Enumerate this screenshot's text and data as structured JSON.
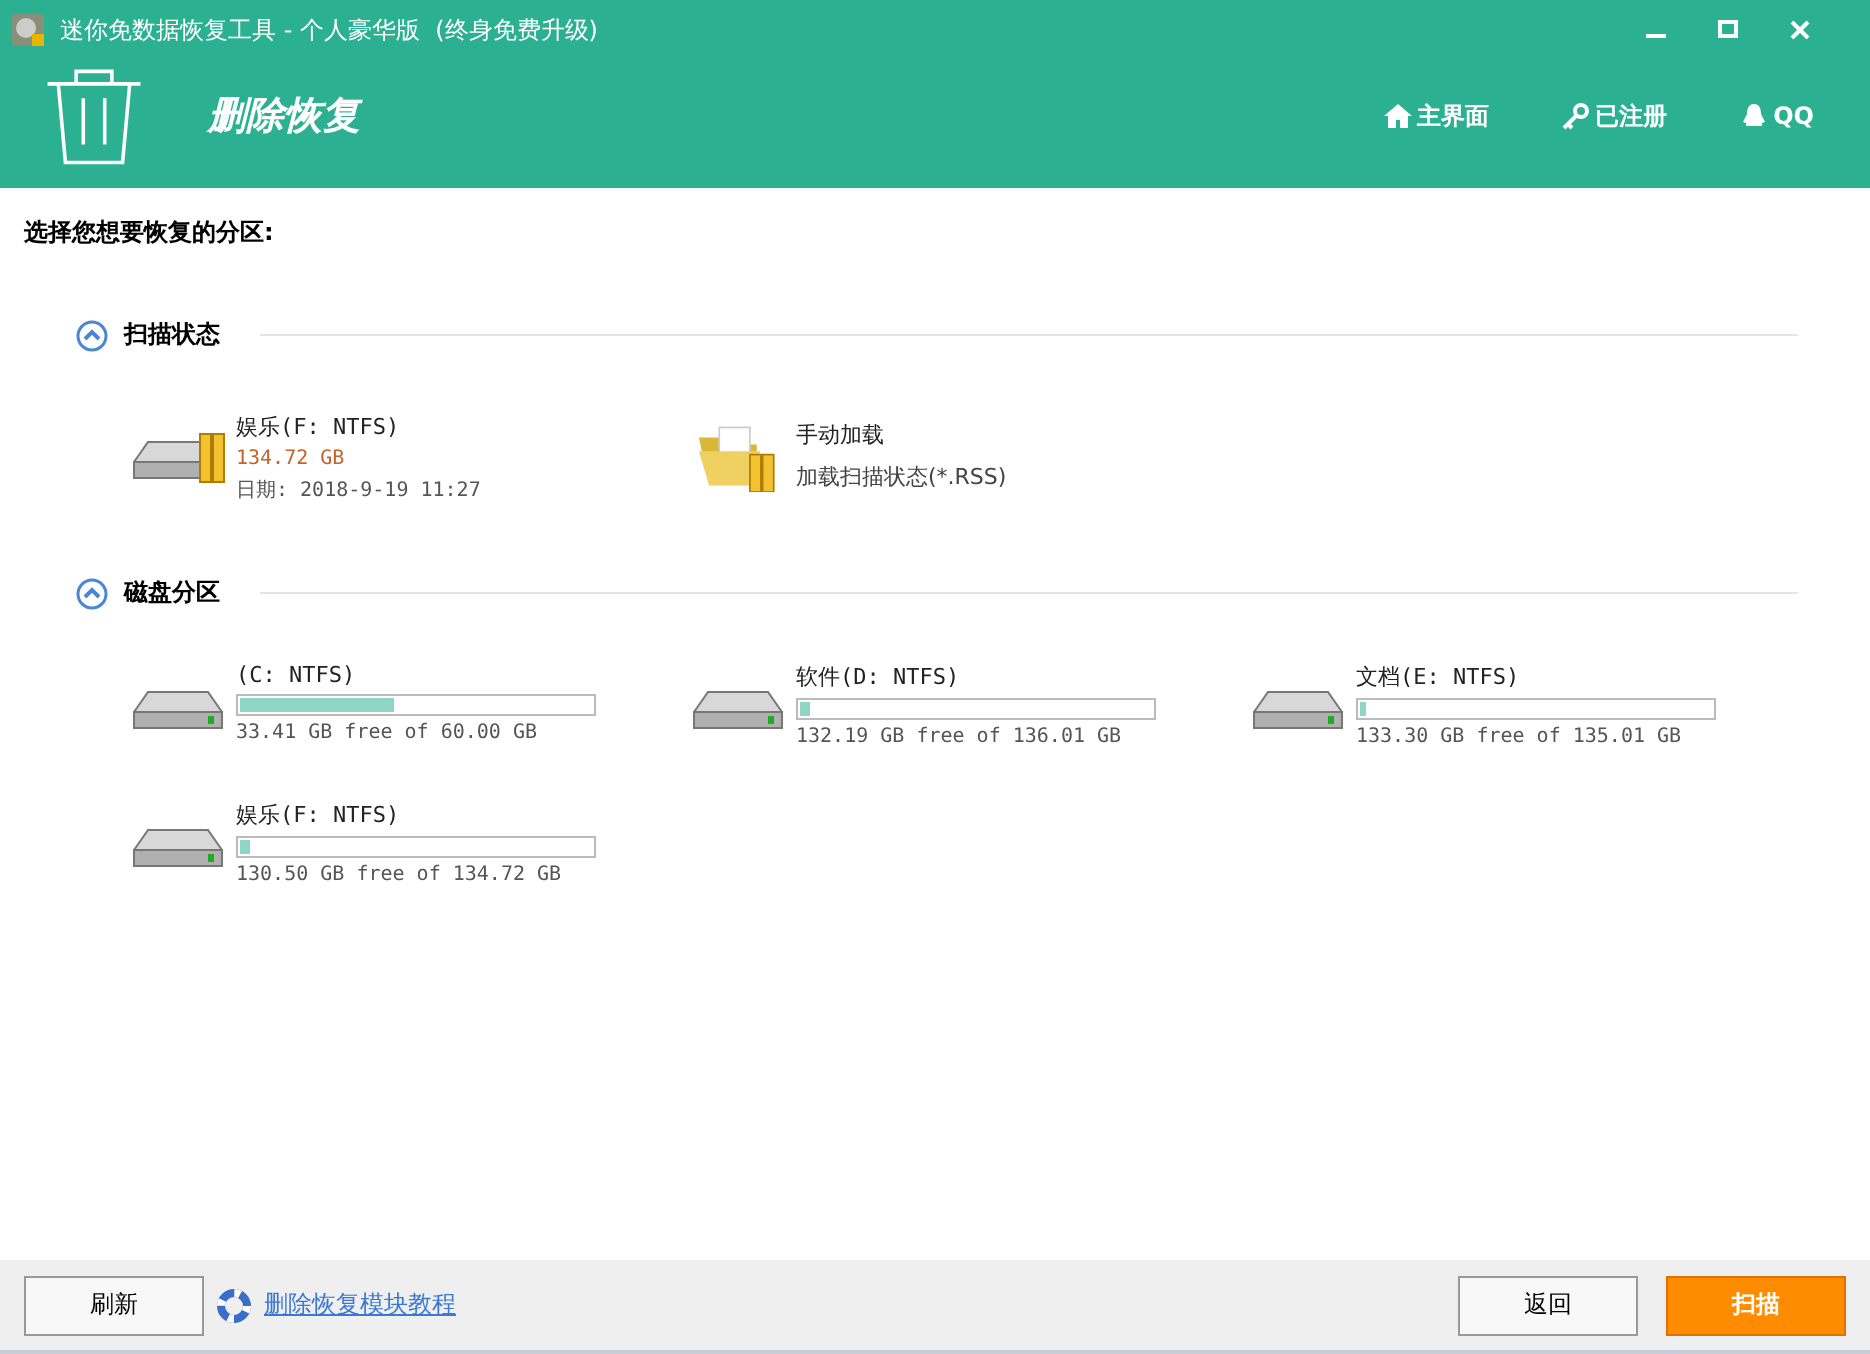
{
  "window": {
    "title": "迷你免数据恢复工具 - 个人豪华版  (终身免费升级)"
  },
  "header": {
    "title": "删除恢复",
    "nav": [
      {
        "kind": "home",
        "label": "主界面"
      },
      {
        "kind": "key",
        "label": "已注册"
      },
      {
        "kind": "qq",
        "label": "QQ"
      }
    ]
  },
  "prompt": "选择您想要恢复的分区:",
  "scan_status": {
    "title": "扫描状态",
    "items": [
      {
        "kind": "saved",
        "name": "娱乐(F: NTFS)",
        "size": "134.72 GB",
        "date": "日期: 2018-9-19 11:27"
      },
      {
        "kind": "load",
        "name": "手动加载",
        "detail": "加载扫描状态(*.RSS)"
      }
    ]
  },
  "partitions": {
    "title": "磁盘分区",
    "items": [
      {
        "name": "(C: NTFS)",
        "level": 0.44,
        "free": "33.41 GB free of 60.00 GB"
      },
      {
        "name": "软件(D: NTFS)",
        "level": 0.03,
        "free": "132.19 GB free of 136.01 GB"
      },
      {
        "name": "文档(E: NTFS)",
        "level": 0.013,
        "free": "133.30 GB free of 135.01 GB"
      },
      {
        "name": "娱乐(F: NTFS)",
        "level": 0.03,
        "free": "130.50 GB free of 134.72 GB"
      }
    ]
  },
  "footer": {
    "refresh": "刷新",
    "tutorial": "删除恢复模块教程",
    "back": "返回",
    "scan": "扫描"
  }
}
